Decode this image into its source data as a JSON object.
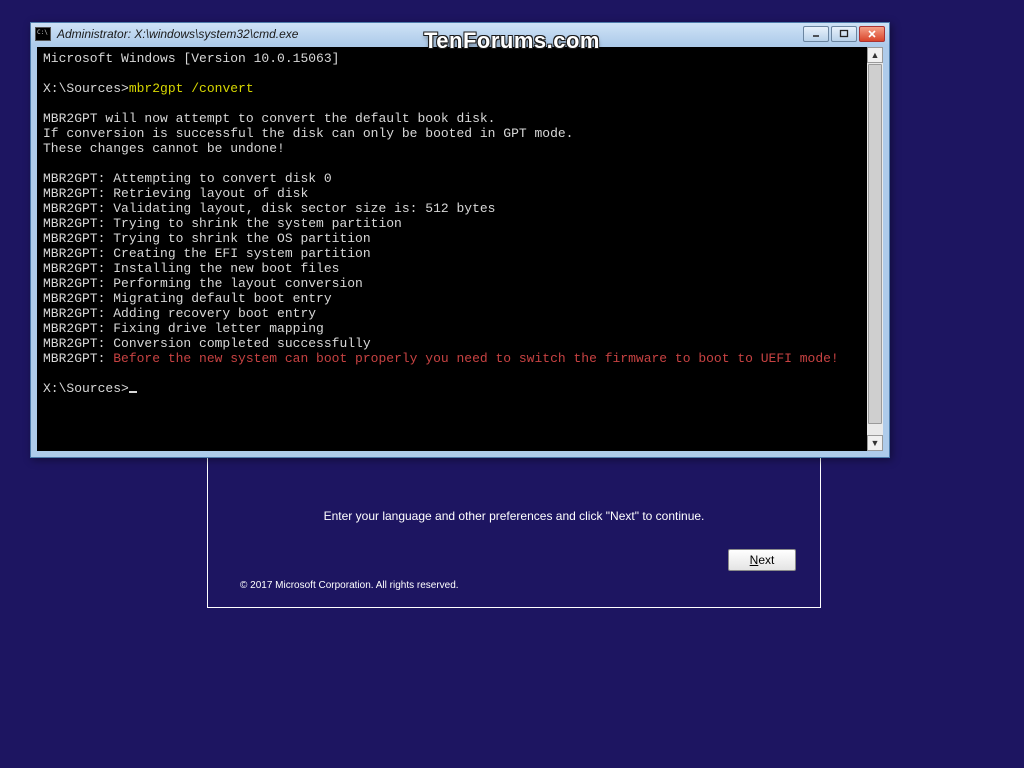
{
  "watermark": "TenForums.com",
  "setup": {
    "instruction": "Enter your language and other preferences and click \"Next\" to continue.",
    "copyright": "© 2017 Microsoft Corporation. All rights reserved.",
    "next_prefix": "N",
    "next_rest": "ext"
  },
  "cmd": {
    "title": "Administrator: X:\\windows\\system32\\cmd.exe",
    "line_version": "Microsoft Windows [Version 10.0.15063]",
    "prompt1_prefix": "X:\\Sources>",
    "prompt1_cmd": "mbr2gpt /convert",
    "body": "MBR2GPT will now attempt to convert the default book disk.\nIf conversion is successful the disk can only be booted in GPT mode.\nThese changes cannot be undone!\n\nMBR2GPT: Attempting to convert disk 0\nMBR2GPT: Retrieving layout of disk\nMBR2GPT: Validating layout, disk sector size is: 512 bytes\nMBR2GPT: Trying to shrink the system partition\nMBR2GPT: Trying to shrink the OS partition\nMBR2GPT: Creating the EFI system partition\nMBR2GPT: Installing the new boot files\nMBR2GPT: Performing the layout conversion\nMBR2GPT: Migrating default boot entry\nMBR2GPT: Adding recovery boot entry\nMBR2GPT: Fixing drive letter mapping\nMBR2GPT: Conversion completed successfully",
    "warn_prefix": "MBR2GPT: ",
    "warn_msg": "Before the new system can boot properly you need to switch the firmware to boot to UEFI mode!",
    "prompt2": "X:\\Sources>"
  }
}
